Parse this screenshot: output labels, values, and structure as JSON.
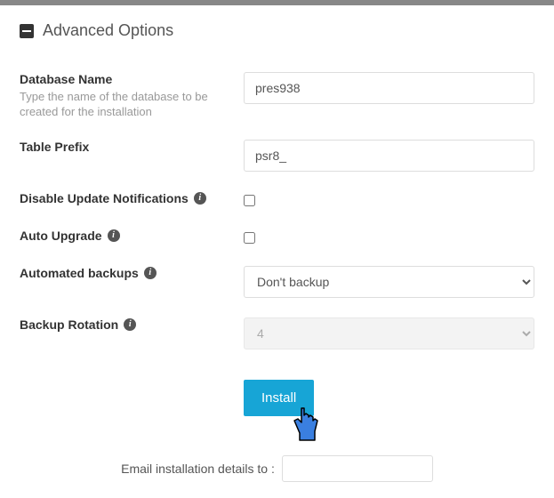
{
  "section": {
    "title": "Advanced Options"
  },
  "fields": {
    "dbname": {
      "label": "Database Name",
      "hint": "Type the name of the database to be created for the installation",
      "value": "pres938"
    },
    "prefix": {
      "label": "Table Prefix",
      "value": "psr8_"
    },
    "disable_notif": {
      "label": "Disable Update Notifications"
    },
    "auto_upgrade": {
      "label": "Auto Upgrade"
    },
    "auto_backup": {
      "label": "Automated backups",
      "selected": "Don't backup"
    },
    "rotation": {
      "label": "Backup Rotation",
      "selected": "4"
    }
  },
  "actions": {
    "install": "Install",
    "email_label": "Email installation details to :",
    "email_value": ""
  }
}
